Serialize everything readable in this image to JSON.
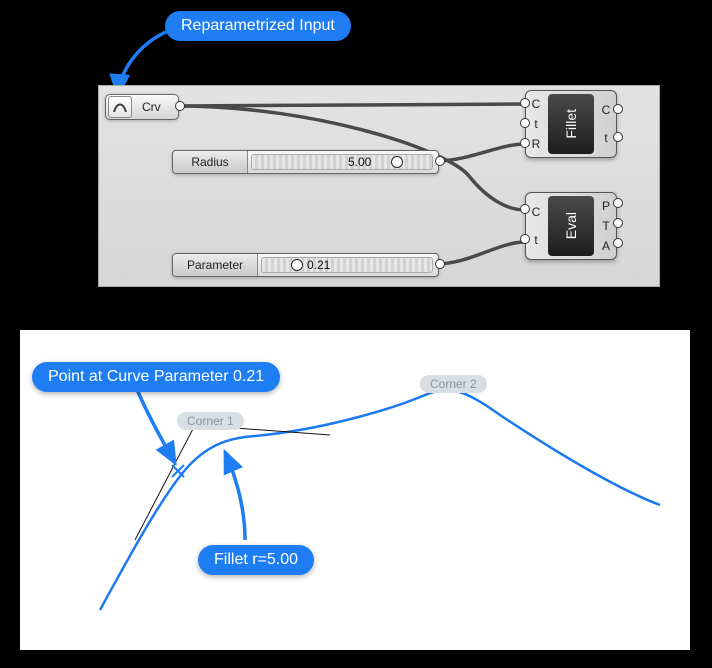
{
  "annotations": {
    "reparametrized": "Reparametrized Input",
    "point_at_param": "Point at Curve Parameter 0.21",
    "fillet_r": "Fillet r=5.00",
    "corner1": "Corner 1",
    "corner2": "Corner 2"
  },
  "graph": {
    "curve_param": {
      "label": "Crv"
    },
    "radius_slider": {
      "label": "Radius",
      "value": "5.00"
    },
    "param_slider": {
      "label": "Parameter",
      "value": "0.21"
    },
    "fillet": {
      "name": "Fillet",
      "in": [
        "C",
        "t",
        "R"
      ],
      "out": [
        "C",
        "t"
      ]
    },
    "eval": {
      "name": "Eval",
      "in": [
        "C",
        "t"
      ],
      "out": [
        "P",
        "T",
        "A"
      ]
    }
  },
  "colors": {
    "accent": "#1e7df2",
    "wire": "#4a4a4a",
    "curve": "#1b7af0"
  }
}
